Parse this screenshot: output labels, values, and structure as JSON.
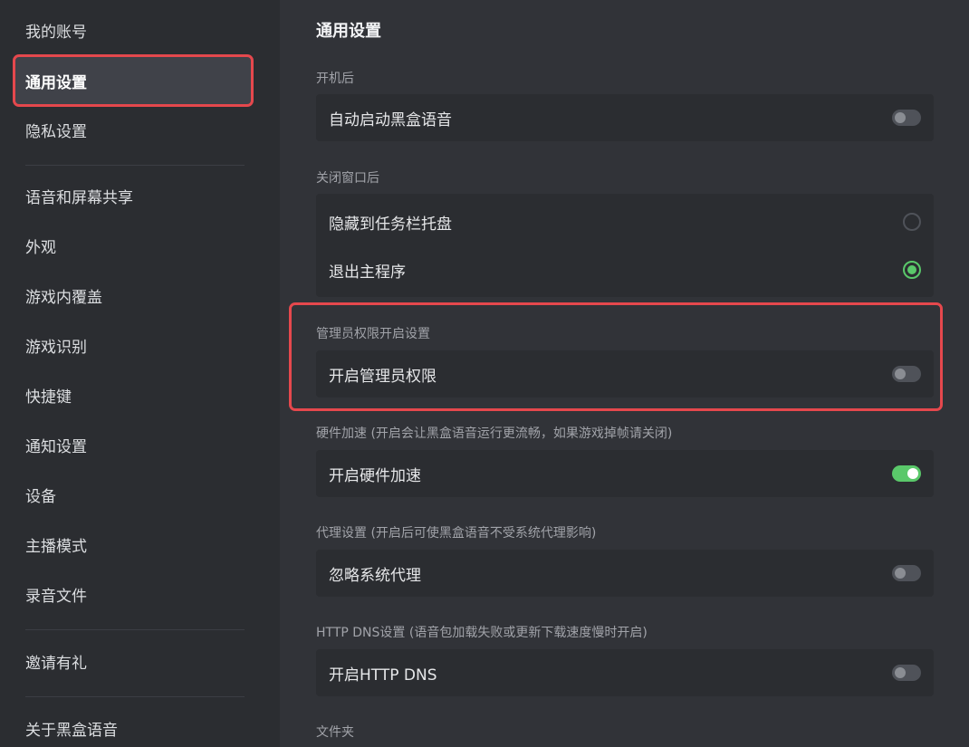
{
  "sidebar": {
    "items": [
      {
        "label": "我的账号"
      },
      {
        "label": "通用设置"
      },
      {
        "label": "隐私设置"
      },
      {
        "label": "语音和屏幕共享"
      },
      {
        "label": "外观"
      },
      {
        "label": "游戏内覆盖"
      },
      {
        "label": "游戏识别"
      },
      {
        "label": "快捷键"
      },
      {
        "label": "通知设置"
      },
      {
        "label": "设备"
      },
      {
        "label": "主播模式"
      },
      {
        "label": "录音文件"
      },
      {
        "label": "邀请有礼"
      },
      {
        "label": "关于黑盒语音"
      }
    ]
  },
  "main": {
    "title": "通用设置",
    "sections": {
      "startup": {
        "label": "开机后",
        "option": "自动启动黑盒语音",
        "enabled": false
      },
      "close_window": {
        "label": "关闭窗口后",
        "option_tray": "隐藏到任务栏托盘",
        "option_exit": "退出主程序",
        "selected": "退出主程序"
      },
      "admin": {
        "label": "管理员权限开启设置",
        "option": "开启管理员权限",
        "enabled": false
      },
      "hardware": {
        "label": "硬件加速 (开启会让黑盒语音运行更流畅，如果游戏掉帧请关闭)",
        "option": "开启硬件加速",
        "enabled": true
      },
      "proxy": {
        "label": "代理设置 (开启后可使黑盒语音不受系统代理影响)",
        "option": "忽略系统代理",
        "enabled": false
      },
      "httpdns": {
        "label": "HTTP DNS设置 (语音包加载失败或更新下载速度慢时开启)",
        "option": "开启HTTP DNS",
        "enabled": false
      },
      "folder": {
        "label": "文件夹"
      }
    }
  },
  "colors": {
    "accent_green": "#5ac86a",
    "highlight_red": "#e5484d",
    "sidebar_bg": "#2b2d31",
    "main_bg": "#313338"
  }
}
